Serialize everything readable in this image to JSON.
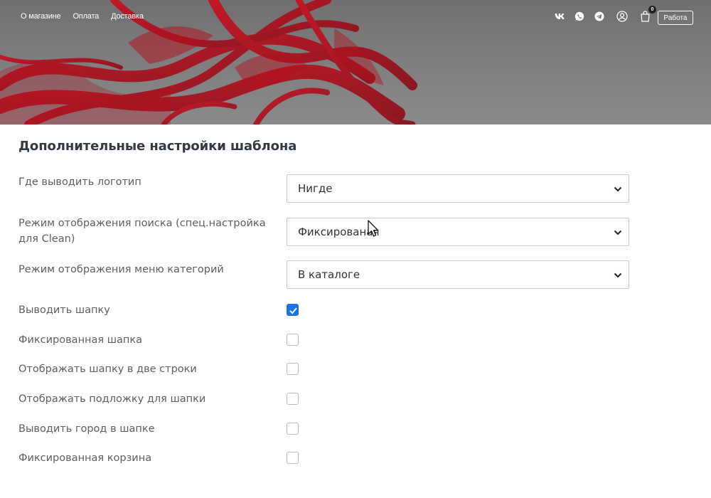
{
  "header": {
    "nav": [
      "О магазине",
      "Оплата",
      "Доставка"
    ],
    "icons": [
      "vk-icon",
      "whatsapp-icon",
      "telegram-icon",
      "user-icon",
      "cart-icon"
    ],
    "cart_count": "0",
    "work_button": "Работа"
  },
  "settings": {
    "title": "Дополнительные настройки шаблона",
    "selects": [
      {
        "label": "Где выводить логотип",
        "value": "Нигде"
      },
      {
        "label": "Режим отображения поиска (спец.настройка для Clean)",
        "value": "Фиксированая"
      },
      {
        "label": "Режим отображения меню категорий",
        "value": "В каталоге"
      }
    ],
    "checkboxes": [
      {
        "label": "Выводить шапку",
        "checked": true
      },
      {
        "label": "Фиксированная шапка",
        "checked": false
      },
      {
        "label": "Отображать шапку в две строки",
        "checked": false
      },
      {
        "label": "Отображать подложку для шапки",
        "checked": false
      },
      {
        "label": "Выводить город в шапке",
        "checked": false
      },
      {
        "label": "Фиксированная корзина",
        "checked": false
      }
    ]
  },
  "colors": {
    "accent": "#1a73e8",
    "hero_red": "#b0121e",
    "hero_gray": "#7a7a7a"
  }
}
